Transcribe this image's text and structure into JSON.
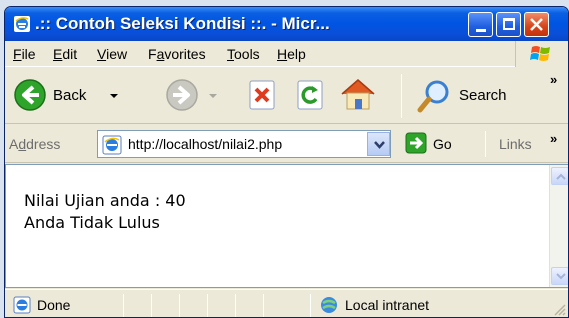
{
  "window": {
    "title": ".:: Contoh Seleksi Kondisi ::. - Micr..."
  },
  "menu": [
    {
      "pre": "",
      "u": "F",
      "post": "ile"
    },
    {
      "pre": "",
      "u": "E",
      "post": "dit"
    },
    {
      "pre": "",
      "u": "V",
      "post": "iew"
    },
    {
      "pre": "F",
      "u": "a",
      "post": "vorites"
    },
    {
      "pre": "",
      "u": "T",
      "post": "ools"
    },
    {
      "pre": "",
      "u": "H",
      "post": "elp"
    }
  ],
  "toolbar": {
    "back_label": "Back",
    "search_label": "Search",
    "chevron": "»"
  },
  "address": {
    "label_pre": "A",
    "label_u": "d",
    "label_post": "dress",
    "url": "http://localhost/nilai2.php",
    "go_label": "Go",
    "links_label": "Links",
    "links_chevron": "»"
  },
  "content": {
    "line1": "Nilai Ujian anda : 40",
    "line2": "Anda Tidak Lulus"
  },
  "status": {
    "text": "Done",
    "zone": "Local intranet"
  },
  "colors": {
    "titlebar": "#0054e3",
    "close_button": "#d64419"
  }
}
